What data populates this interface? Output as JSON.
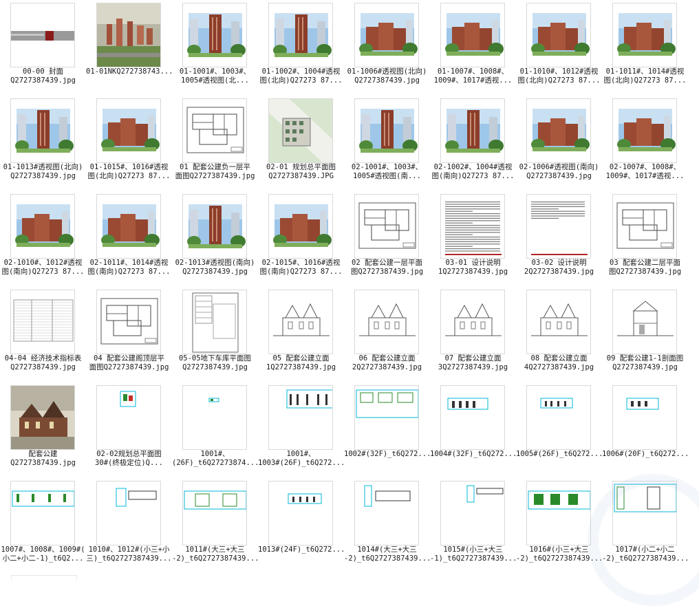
{
  "items": [
    {
      "l1": "00-00 封面",
      "l2": "Q2727387439.jpg",
      "type": "cover"
    },
    {
      "l1": "01-01NKQ272738743...",
      "l2": "",
      "type": "aerial"
    },
    {
      "l1": "01-1001#、1003#、",
      "l2": "1005#透视图(北...",
      "type": "tower"
    },
    {
      "l1": "01-1002#、1004#透视",
      "l2": "图(北向)Q27273 87...",
      "type": "tower"
    },
    {
      "l1": "01-1006#透视图(北向)",
      "l2": "Q2727387439.jpg",
      "type": "estate"
    },
    {
      "l1": "01-1007#、1008#、",
      "l2": "1009#、1017#透视...",
      "type": "estate"
    },
    {
      "l1": "01-1010#、1012#透视",
      "l2": "图(北向)Q27273 87...",
      "type": "estate"
    },
    {
      "l1": "01-1011#、1014#透视",
      "l2": "图(北向)Q27273 87...",
      "type": "estate"
    },
    {
      "l1": "01-1013#透视图(北向)",
      "l2": "Q2727387439.jpg",
      "type": "tower"
    },
    {
      "l1": "01-1015#、1016#透视",
      "l2": "图(北向)Q27273 87...",
      "type": "estate"
    },
    {
      "l1": "01 配套公建负一层平",
      "l2": "面图Q2727387439.jpg",
      "type": "plan"
    },
    {
      "l1": "02-01 规划总平面图",
      "l2": "Q2727387439.JPG",
      "type": "siteplan"
    },
    {
      "l1": "02-1001#、1003#、",
      "l2": "1005#透视图(南...",
      "type": "tower"
    },
    {
      "l1": "02-1002#、1004#透视",
      "l2": "图(南向)Q27273 87...",
      "type": "tower"
    },
    {
      "l1": "02-1006#透视图(南向)",
      "l2": "Q2727387439.jpg",
      "type": "estate"
    },
    {
      "l1": "02-1007#、1008#、",
      "l2": "1009#、1017#透视...",
      "type": "estate"
    },
    {
      "l1": "02-1010#、1012#透视",
      "l2": "图(南向)Q27273 87...",
      "type": "estate"
    },
    {
      "l1": "02-1011#、1014#透视",
      "l2": "图(南向)Q27273 87...",
      "type": "estate"
    },
    {
      "l1": "02-1013#透视图(南向)",
      "l2": "Q2727387439.jpg",
      "type": "tower"
    },
    {
      "l1": "02-1015#、1016#透视",
      "l2": "图(南向)Q27273 87...",
      "type": "estate"
    },
    {
      "l1": "02 配套公建一层平面",
      "l2": "图Q2727387439.jpg",
      "type": "plan"
    },
    {
      "l1": "03-01 设计说明",
      "l2": "1Q2727387439.jpg",
      "type": "text"
    },
    {
      "l1": "03-02 设计说明",
      "l2": "2Q2727387439.jpg",
      "type": "text2"
    },
    {
      "l1": "03 配套公建二层平面",
      "l2": "图Q2727387439.jpg",
      "type": "plan"
    },
    {
      "l1": "04-04 经济技术指标表",
      "l2": "Q2727387439.jpg",
      "type": "table"
    },
    {
      "l1": "04 配套公建阁顶层平",
      "l2": "面图Q2727387439.jpg",
      "type": "plan"
    },
    {
      "l1": "05-05地下车库平面图",
      "l2": "Q2727387439.jpg",
      "type": "garage"
    },
    {
      "l1": "05 配套公建立面",
      "l2": "1Q2727387439.jpg",
      "type": "elev"
    },
    {
      "l1": "06 配套公建立面",
      "l2": "2Q2727387439.jpg",
      "type": "elev"
    },
    {
      "l1": "07 配套公建立面",
      "l2": "3Q2727387439.jpg",
      "type": "elev"
    },
    {
      "l1": "08 配套公建立面",
      "l2": "4Q2727387439.jpg",
      "type": "elev"
    },
    {
      "l1": "09 配套公建1-1剖面图",
      "l2": "Q2727387439.jpg",
      "type": "section"
    },
    {
      "l1": "配套公建",
      "l2": "Q2727387439.jpg",
      "type": "clubhouse"
    },
    {
      "l1": "02-02规划总平面图",
      "l2": "30#(终极定位)Q...",
      "type": "cad1"
    },
    {
      "l1": "1001#、",
      "l2": "(26F)_t6Q27273874...",
      "type": "cad2"
    },
    {
      "l1": "1001#、",
      "l2": "1003#(26F)_t6Q272...",
      "type": "cad3"
    },
    {
      "l1": "1002#(32F)_t6Q272...",
      "l2": "",
      "type": "cad4"
    },
    {
      "l1": "1004#(32F)_t6Q272...",
      "l2": "",
      "type": "cad5"
    },
    {
      "l1": "1005#(26F)_t6Q272...",
      "l2": "",
      "type": "cad6"
    },
    {
      "l1": "1006#(20F)_t6Q272...",
      "l2": "",
      "type": "cad7"
    },
    {
      "l1": "1007#、1008#、1009#(",
      "l2": "小二+小二-1)_t6Q2...",
      "type": "cad8"
    },
    {
      "l1": "1010#、1012#(小三+小",
      "l2": "三)_t6Q2727387439...",
      "type": "cad9"
    },
    {
      "l1": "1011#(大三+大三",
      "l2": "-2)_t6Q2727387439...",
      "type": "cad10"
    },
    {
      "l1": "1013#(24F)_t6Q272...",
      "l2": "",
      "type": "cad11"
    },
    {
      "l1": "1014#(大三+大三",
      "l2": "-2)_t6Q2727387439...",
      "type": "cad12"
    },
    {
      "l1": "1015#(小三+大三",
      "l2": "-1)_t6Q2727387439...",
      "type": "cad13"
    },
    {
      "l1": "1016#(小三+大三",
      "l2": "-2)_t6Q2727387439...",
      "type": "cad14"
    },
    {
      "l1": "1017#(小二+小二",
      "l2": "-2)_t6Q2727387439...",
      "type": "cad15"
    }
  ]
}
